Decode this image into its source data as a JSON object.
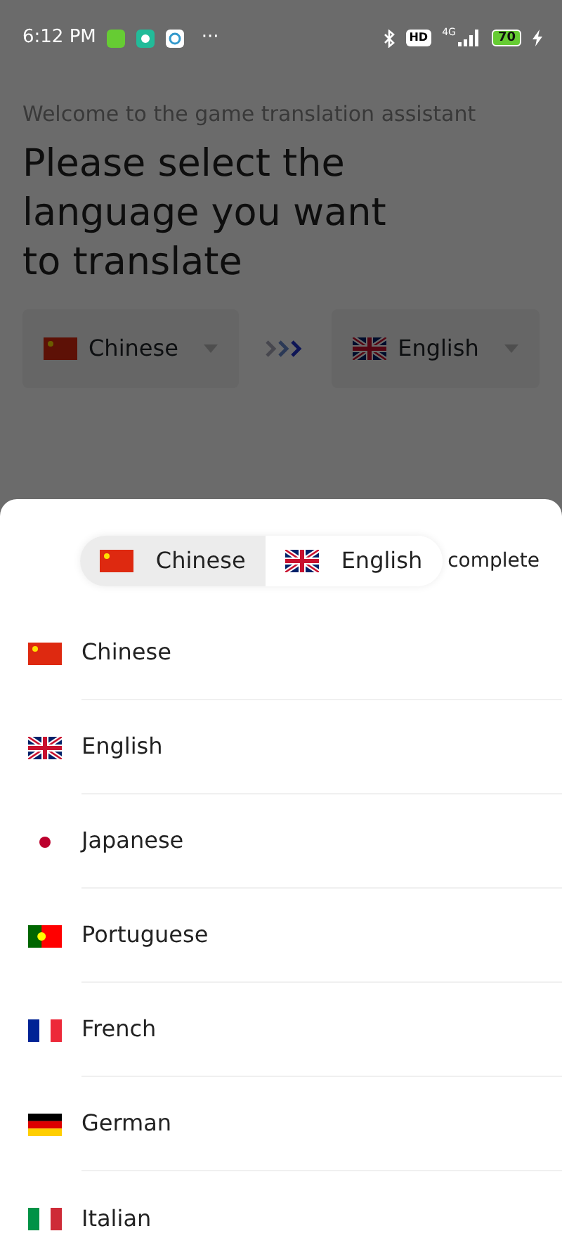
{
  "status_bar": {
    "time": "6:12 PM",
    "more": "···",
    "network": "4G",
    "hd": "HD",
    "battery": "70"
  },
  "screen": {
    "subtitle": "Welcome to the game translation assistant",
    "title": "Please select the language you want to translate",
    "source": "Chinese",
    "target": "English"
  },
  "sheet": {
    "tabs": [
      {
        "label": "Chinese",
        "selected": true
      },
      {
        "label": "English",
        "selected": false
      }
    ],
    "complete": "complete",
    "languages": [
      {
        "label": "Chinese"
      },
      {
        "label": "English"
      },
      {
        "label": "Japanese"
      },
      {
        "label": "Portuguese"
      },
      {
        "label": "French"
      },
      {
        "label": "German"
      },
      {
        "label": "Italian"
      }
    ]
  }
}
